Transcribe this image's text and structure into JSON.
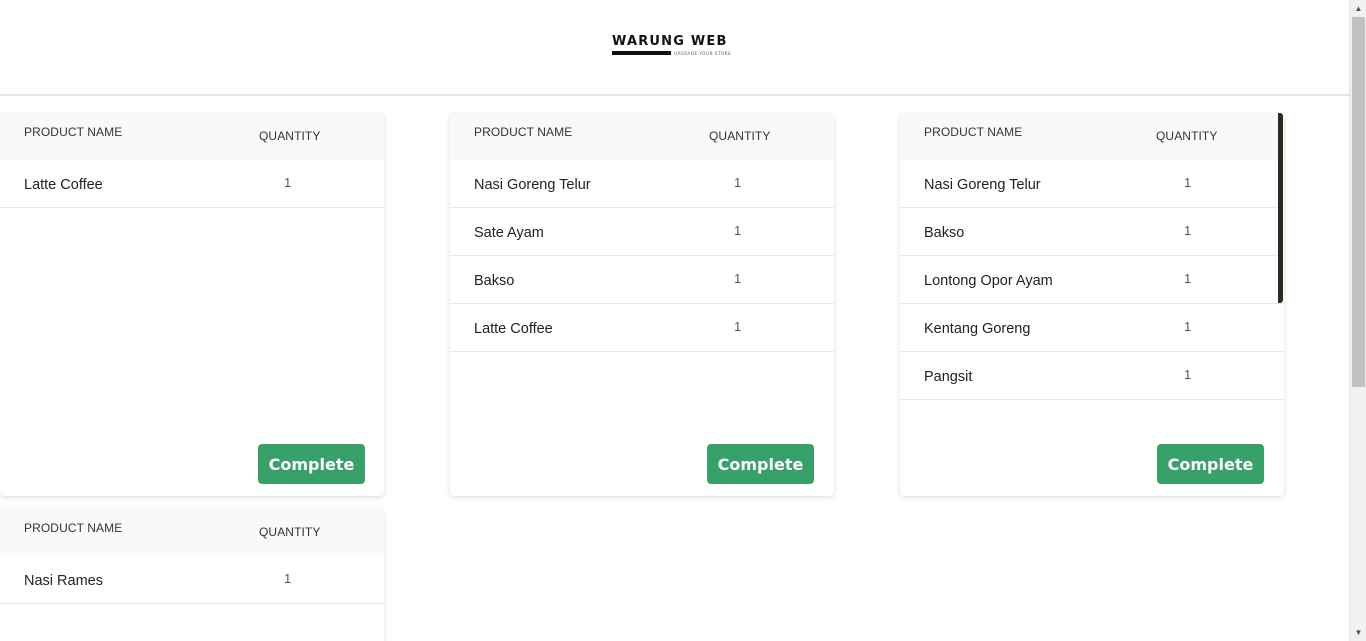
{
  "header": {
    "logo_text": "WARUNG WEB",
    "logo_tagline": "UPGRADE YOUR STORE"
  },
  "orders": [
    {
      "col_name": "PRODUCT NAME",
      "col_qty": "QUANTITY",
      "items": [
        {
          "name": "Latte Coffee",
          "qty": "1"
        }
      ],
      "button": "Complete"
    },
    {
      "col_name": "PRODUCT NAME",
      "col_qty": "QUANTITY",
      "items": [
        {
          "name": "Nasi Goreng Telur",
          "qty": "1"
        },
        {
          "name": "Sate Ayam",
          "qty": "1"
        },
        {
          "name": "Bakso",
          "qty": "1"
        },
        {
          "name": "Latte Coffee",
          "qty": "1"
        }
      ],
      "button": "Complete"
    },
    {
      "col_name": "PRODUCT NAME",
      "col_qty": "QUANTITY",
      "items": [
        {
          "name": "Nasi Goreng Telur",
          "qty": "1"
        },
        {
          "name": "Bakso",
          "qty": "1"
        },
        {
          "name": "Lontong Opor Ayam",
          "qty": "1"
        },
        {
          "name": "Kentang Goreng",
          "qty": "1"
        },
        {
          "name": "Pangsit",
          "qty": "1"
        }
      ],
      "button": "Complete"
    },
    {
      "col_name": "PRODUCT NAME",
      "col_qty": "QUANTITY",
      "items": [
        {
          "name": "Nasi Rames",
          "qty": "1"
        }
      ]
    }
  ],
  "colors": {
    "complete_button": "#38a169",
    "header_row": "#f8f9fb",
    "accent_bar": "#2d2a1e"
  },
  "scrollbar": {
    "up_icon": "chevron-up-icon",
    "down_icon": "chevron-down-icon"
  }
}
